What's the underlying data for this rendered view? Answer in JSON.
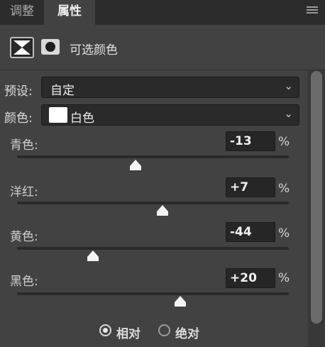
{
  "tabs": [
    {
      "label": "调整"
    },
    {
      "label": "属性"
    }
  ],
  "panel": {
    "title": "可选颜色",
    "icons": {
      "adjustment": "selective-color-adjustment-icon",
      "mask": "layer-mask-icon",
      "menu": "panel-menu-icon"
    }
  },
  "preset": {
    "label": "预设:",
    "value": "自定"
  },
  "colors": {
    "label": "颜色:",
    "value": "白色",
    "swatch": "#ffffff"
  },
  "sliders": [
    {
      "label": "青色:",
      "value": "-13",
      "unit": "%",
      "numeric": -13
    },
    {
      "label": "洋红:",
      "value": "+7",
      "unit": "%",
      "numeric": 7
    },
    {
      "label": "黄色:",
      "value": "-44",
      "unit": "%",
      "numeric": -44
    },
    {
      "label": "黑色:",
      "value": "+20",
      "unit": "%",
      "numeric": 20
    }
  ],
  "method": {
    "options": [
      {
        "label": "相对",
        "selected": true
      },
      {
        "label": "绝对",
        "selected": false
      }
    ]
  }
}
